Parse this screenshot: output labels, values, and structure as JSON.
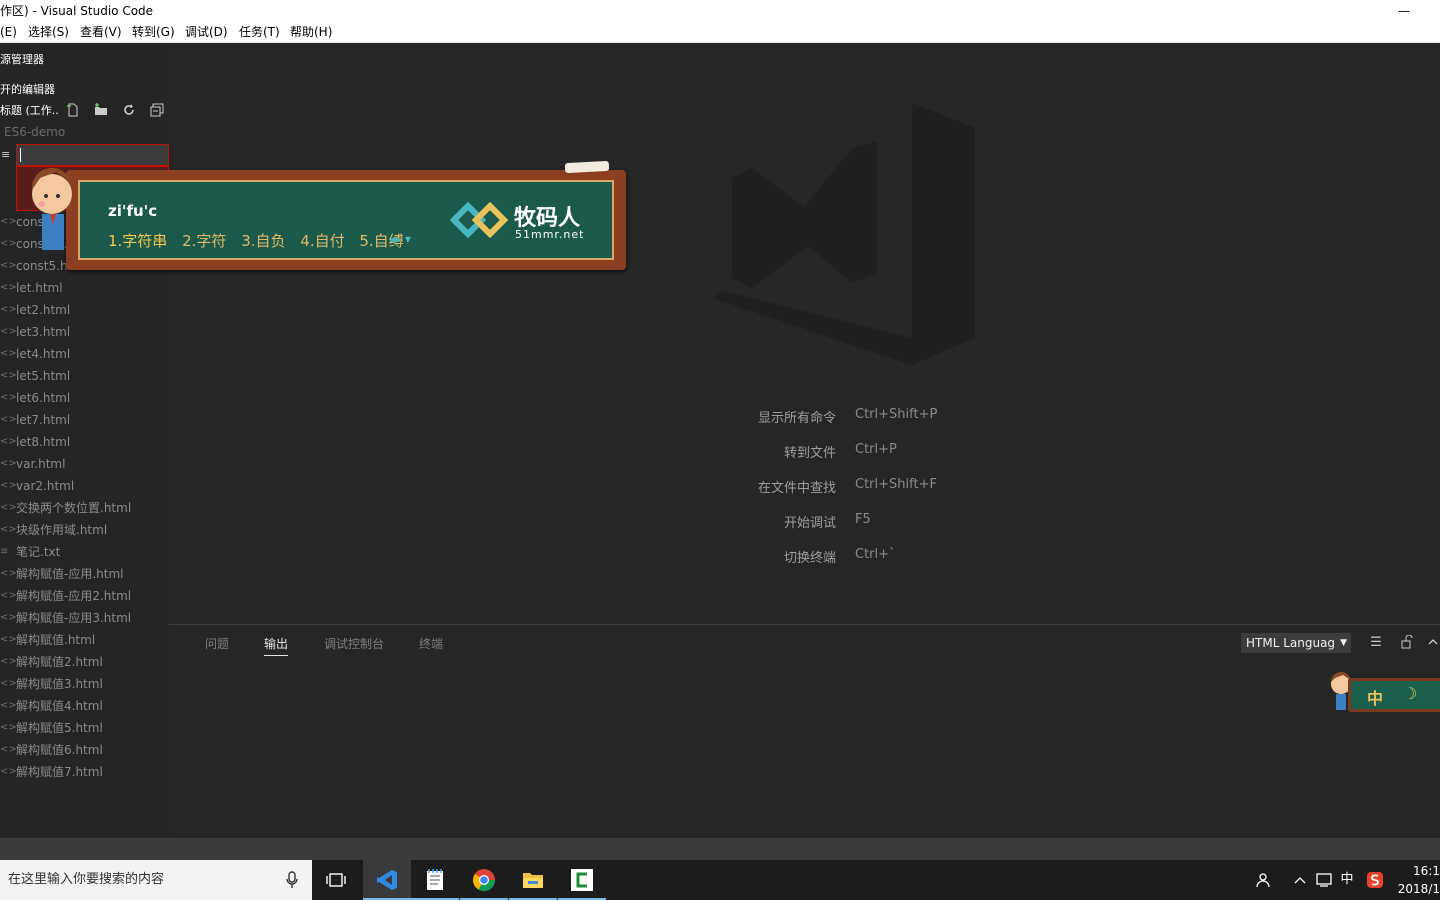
{
  "window": {
    "title": "作区) - Visual Studio Code",
    "minimize": "—"
  },
  "menu": {
    "items": [
      "(E)",
      "选择(S)",
      "查看(V)",
      "转到(G)",
      "调试(D)",
      "任务(T)",
      "帮助(H)"
    ]
  },
  "sidebar": {
    "explorer_title": "源管理器",
    "open_editors": "开的编辑器",
    "workspace_header": "标题 (工作..",
    "actions": [
      "new-file-icon",
      "new-folder-icon",
      "refresh-icon",
      "collapse-all-icon"
    ],
    "folder": "ES6-demo",
    "new_file_icon": "≡",
    "files": [
      {
        "name": "const...",
        "icon": "<>"
      },
      {
        "name": "const4...",
        "icon": "<>"
      },
      {
        "name": "const5.htm...",
        "icon": "<>"
      },
      {
        "name": "let.html",
        "icon": "<>"
      },
      {
        "name": "let2.html",
        "icon": "<>"
      },
      {
        "name": "let3.html",
        "icon": "<>"
      },
      {
        "name": "let4.html",
        "icon": "<>"
      },
      {
        "name": "let5.html",
        "icon": "<>"
      },
      {
        "name": "let6.html",
        "icon": "<>"
      },
      {
        "name": "let7.html",
        "icon": "<>"
      },
      {
        "name": "let8.html",
        "icon": "<>"
      },
      {
        "name": "var.html",
        "icon": "<>"
      },
      {
        "name": "var2.html",
        "icon": "<>"
      },
      {
        "name": "交换两个数位置.html",
        "icon": "<>"
      },
      {
        "name": "块级作用域.html",
        "icon": "<>"
      },
      {
        "name": "笔记.txt",
        "icon": "≡"
      },
      {
        "name": "解构赋值-应用.html",
        "icon": "<>"
      },
      {
        "name": "解构赋值-应用2.html",
        "icon": "<>"
      },
      {
        "name": "解构赋值-应用3.html",
        "icon": "<>"
      },
      {
        "name": "解构赋值.html",
        "icon": "<>"
      },
      {
        "name": "解构赋值2.html",
        "icon": "<>"
      },
      {
        "name": "解构赋值3.html",
        "icon": "<>"
      },
      {
        "name": "解构赋值4.html",
        "icon": "<>"
      },
      {
        "name": "解构赋值5.html",
        "icon": "<>"
      },
      {
        "name": "解构赋值6.html",
        "icon": "<>"
      },
      {
        "name": "解构赋值7.html",
        "icon": "<>"
      }
    ]
  },
  "editor": {
    "shortcuts": [
      {
        "label": "显示所有命令",
        "key": "Ctrl+Shift+P"
      },
      {
        "label": "转到文件",
        "key": "Ctrl+P"
      },
      {
        "label": "在文件中查找",
        "key": "Ctrl+Shift+F"
      },
      {
        "label": "开始调试",
        "key": "F5"
      },
      {
        "label": "切换终端",
        "key": "Ctrl+`"
      }
    ]
  },
  "panel": {
    "tabs": [
      {
        "label": "问题",
        "active": false
      },
      {
        "label": "输出",
        "active": true
      },
      {
        "label": "调试控制台",
        "active": false
      },
      {
        "label": "终端",
        "active": false
      }
    ],
    "output_select": "HTML Languag",
    "icons": [
      "clear-output-icon",
      "lock-scroll-icon",
      "maximize-panel-icon"
    ]
  },
  "ime": {
    "pinyin": "zi'fu'c",
    "candidates": [
      "1.字符串",
      "2.字符",
      "3.自负",
      "4.自付",
      "5.自缚"
    ],
    "brand": "牧码人",
    "brand_url": "51mmr.net",
    "mini_mode": "中",
    "mini_moon": "☽"
  },
  "taskbar": {
    "search_placeholder": "在这里输入你要搜索的内容",
    "apps": [
      "vscode-icon",
      "notepad-icon",
      "chrome-icon",
      "file-explorer-icon",
      "camtasia-icon"
    ],
    "tray_lang": "中",
    "time": "16:1",
    "date": "2018/1"
  },
  "colors": {
    "accent": "#007acc",
    "error_border": "#be1100",
    "ime_board": "#1b5a4b",
    "ime_frame": "#8a3f22"
  }
}
